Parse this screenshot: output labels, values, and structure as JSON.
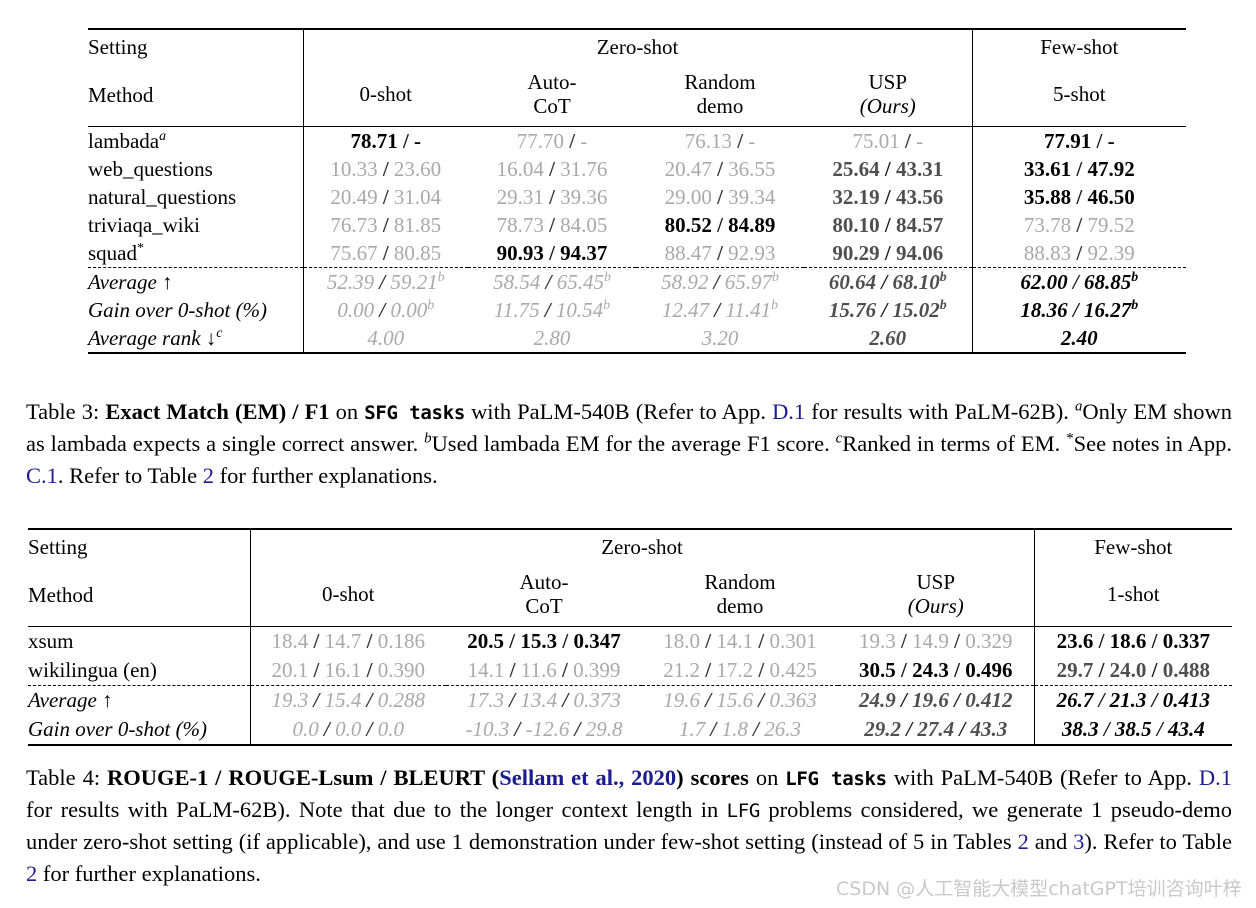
{
  "table3": {
    "corner": {
      "setting_label": "Setting",
      "method_label": "Method"
    },
    "groups": [
      {
        "label": "Zero-shot",
        "span": 4
      },
      {
        "label": "Few-shot",
        "span": 1
      }
    ],
    "columns": [
      {
        "line1": "0-shot",
        "line2": ""
      },
      {
        "line1": "Auto-",
        "line2": "CoT"
      },
      {
        "line1": "Random",
        "line2": "demo"
      },
      {
        "line1": "USP",
        "line2": "(Ours)"
      },
      {
        "line1": "",
        "line2": "5-shot"
      }
    ],
    "rows": [
      {
        "name": "lambada",
        "name_sup": "a",
        "values": [
          "78.71 / -",
          "77.70 / -",
          "76.13 / -",
          "75.01 / -",
          "77.91 / -"
        ],
        "styles": [
          "dark",
          "dim",
          "dim",
          "dim",
          "dark"
        ]
      },
      {
        "name": "web_questions",
        "name_sup": "",
        "values": [
          "10.33 / 23.60",
          "16.04 / 31.76",
          "20.47 / 36.55",
          "25.64 / 43.31",
          "33.61 / 47.92"
        ],
        "styles": [
          "dim",
          "dim",
          "dim",
          "mid",
          "dark"
        ]
      },
      {
        "name": "natural_questions",
        "name_sup": "",
        "values": [
          "20.49 / 31.04",
          "29.31 / 39.36",
          "29.00 / 39.34",
          "32.19 / 43.56",
          "35.88 / 46.50"
        ],
        "styles": [
          "dim",
          "dim",
          "dim",
          "mid",
          "dark"
        ]
      },
      {
        "name": "triviaqa_wiki",
        "name_sup": "",
        "values": [
          "76.73 / 81.85",
          "78.73 / 84.05",
          "80.52 / 84.89",
          "80.10 / 84.57",
          "73.78 / 79.52"
        ],
        "styles": [
          "dim",
          "dim",
          "dark",
          "mid",
          "dim"
        ]
      },
      {
        "name": "squad",
        "name_sup": "*",
        "values": [
          "75.67 / 80.85",
          "90.93 / 94.37",
          "88.47 / 92.93",
          "90.29 / 94.06",
          "88.83 / 92.39"
        ],
        "styles": [
          "dim",
          "dark",
          "dim",
          "mid",
          "dim"
        ]
      }
    ],
    "summary_rows": [
      {
        "name": "Average ↑",
        "name_sup": "",
        "values": [
          "52.39 / 59.21",
          "58.54 / 65.45",
          "58.92 / 65.97",
          "60.64 / 68.10",
          "62.00 / 68.85"
        ],
        "sups": [
          "b",
          "b",
          "b",
          "b",
          "b"
        ],
        "styles": [
          "dim",
          "dim",
          "dim",
          "mid",
          "dark"
        ]
      },
      {
        "name": "Gain over 0-shot (%)",
        "name_sup": "",
        "values": [
          "0.00 / 0.00",
          "11.75 / 10.54",
          "12.47 / 11.41",
          "15.76 / 15.02",
          "18.36 / 16.27"
        ],
        "sups": [
          "b",
          "b",
          "b",
          "b",
          "b"
        ],
        "styles": [
          "dim",
          "dim",
          "dim",
          "mid",
          "dark"
        ]
      },
      {
        "name": "Average rank ↓",
        "name_sup": "c",
        "values": [
          "4.00",
          "2.80",
          "3.20",
          "2.60",
          "2.40"
        ],
        "sups": [
          "",
          "",
          "",
          "",
          ""
        ],
        "styles": [
          "dim",
          "dim",
          "dim",
          "mid",
          "dark"
        ]
      }
    ]
  },
  "table4": {
    "corner": {
      "setting_label": "Setting",
      "method_label": "Method"
    },
    "groups": [
      {
        "label": "Zero-shot",
        "span": 4
      },
      {
        "label": "Few-shot",
        "span": 1
      }
    ],
    "columns": [
      {
        "line1": "0-shot",
        "line2": ""
      },
      {
        "line1": "Auto-",
        "line2": "CoT"
      },
      {
        "line1": "Random",
        "line2": "demo"
      },
      {
        "line1": "USP",
        "line2": "(Ours)"
      },
      {
        "line1": "",
        "line2": "1-shot"
      }
    ],
    "rows": [
      {
        "name": "xsum",
        "name_sup": "",
        "values": [
          "18.4 / 14.7 / 0.186",
          "20.5 / 15.3 / 0.347",
          "18.0 / 14.1 / 0.301",
          "19.3 / 14.9 / 0.329",
          "23.6 / 18.6 / 0.337"
        ],
        "styles": [
          "dim",
          "dark",
          "dim",
          "dim",
          "dark"
        ]
      },
      {
        "name": "wikilingua (en)",
        "name_sup": "",
        "values": [
          "20.1 / 16.1 / 0.390",
          "14.1 / 11.6 / 0.399",
          "21.2 / 17.2 / 0.425",
          "30.5 / 24.3 / 0.496",
          "29.7 / 24.0 / 0.488"
        ],
        "styles": [
          "dim",
          "dim",
          "dim",
          "dark",
          "mid"
        ]
      }
    ],
    "summary_rows": [
      {
        "name": "Average ↑",
        "name_sup": "",
        "values": [
          "19.3 / 15.4 / 0.288",
          "17.3 / 13.4 / 0.373",
          "19.6 / 15.6 / 0.363",
          "24.9 / 19.6 / 0.412",
          "26.7 / 21.3 / 0.413"
        ],
        "sups": [
          "",
          "",
          "",
          "",
          ""
        ],
        "styles": [
          "dim",
          "dim",
          "dim",
          "mid",
          "dark"
        ]
      },
      {
        "name": "Gain over 0-shot (%)",
        "name_sup": "",
        "values": [
          "0.0 / 0.0 / 0.0",
          "-10.3 / -12.6 / 29.8",
          "1.7 / 1.8 / 26.3",
          "29.2 / 27.4 / 43.3",
          "38.3 / 38.5 / 43.4"
        ],
        "sups": [
          "",
          "",
          "",
          "",
          ""
        ],
        "styles": [
          "dim",
          "dim",
          "dim",
          "mid",
          "dark"
        ]
      }
    ]
  },
  "caption3": {
    "label": "Table 3:",
    "bold1": "Exact Match (EM) / F1",
    "mid1": " on ",
    "mono1": "SFG tasks",
    "mid2": " with PaLM-540B (Refer to App. ",
    "link1": "D.1",
    "mid3": " for results with PaLM-62B). ",
    "foot_a_sup": "a",
    "foot_a": "Only EM shown as lambada expects a single correct answer. ",
    "foot_b_sup": "b",
    "foot_b": "Used lambada EM for the average F1 score. ",
    "foot_c_sup": "c",
    "foot_c": "Ranked in terms of EM. ",
    "star": "*",
    "foot_star": "See notes in App. ",
    "link2": "C.1",
    "mid4": ". Refer to Table ",
    "link3": "2",
    "mid5": " for further explanations."
  },
  "caption4": {
    "label": "Table 4:",
    "bold1": "ROUGE-1 / ROUGE-Lsum / BLEURT (",
    "link1": "Sellam et al., 2020",
    "bold2": ") scores",
    "mid1": " on ",
    "mono1": "LFG tasks",
    "mid2": " with PaLM-540B (Refer to App. ",
    "link2": "D.1",
    "mid3": " for results with PaLM-62B). Note that due to the longer context length in ",
    "mono2": "LFG",
    "mid4": " problems considered, we generate 1 pseudo-demo under zero-shot setting (if applicable), and use 1 demonstration under few-shot setting (instead of 5 in Tables ",
    "link3": "2",
    "mid5": " and ",
    "link4": "3",
    "mid6": "). Refer to Table ",
    "link5": "2",
    "mid7": " for further explanations."
  },
  "watermark": {
    "text": "CSDN @人工智能大模型chatGPT培训咨询叶梓"
  },
  "colors": {
    "link": "#1c1c8f",
    "dim": "#a9a9a9",
    "mid": "#4f4f4f",
    "dark": "#000000"
  }
}
